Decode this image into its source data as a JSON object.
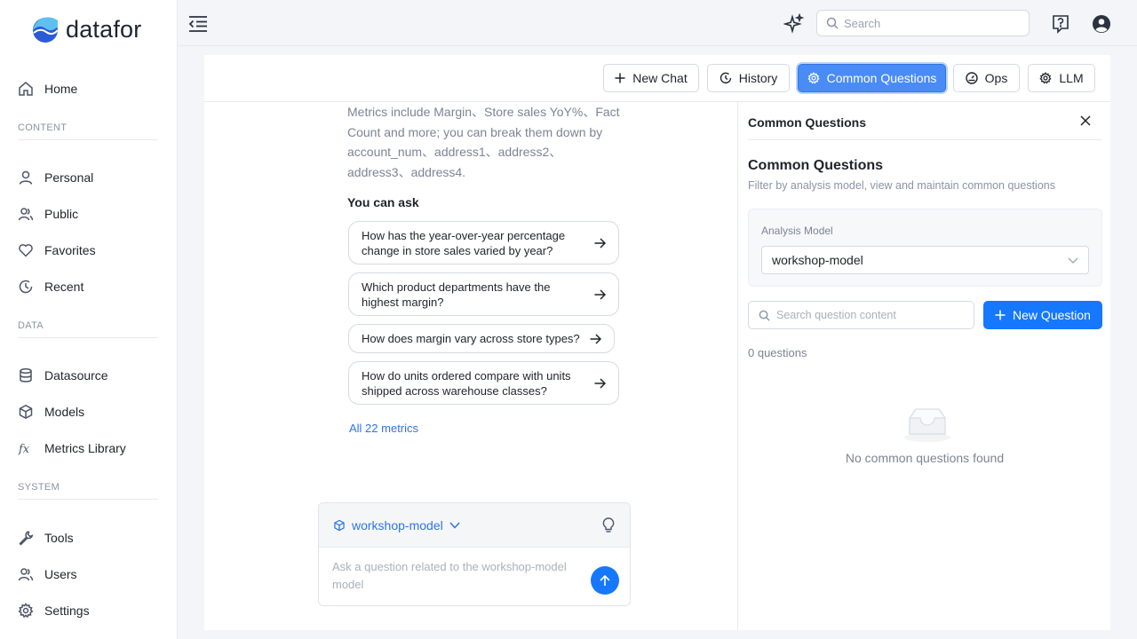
{
  "app": {
    "brand": "datafor"
  },
  "sidebar": {
    "home": "Home",
    "sections": {
      "content": "CONTENT",
      "data": "DATA",
      "system": "SYSTEM"
    },
    "content_items": [
      {
        "label": "Personal",
        "icon": "user-icon"
      },
      {
        "label": "Public",
        "icon": "users-icon"
      },
      {
        "label": "Favorites",
        "icon": "heart-icon"
      },
      {
        "label": "Recent",
        "icon": "clock-icon"
      }
    ],
    "data_items": [
      {
        "label": "Datasource",
        "icon": "database-icon"
      },
      {
        "label": "Models",
        "icon": "cube-icon"
      },
      {
        "label": "Metrics Library",
        "icon": "function-icon"
      }
    ],
    "system_items": [
      {
        "label": "Tools",
        "icon": "wrench-icon"
      },
      {
        "label": "Users",
        "icon": "users-icon"
      },
      {
        "label": "Settings",
        "icon": "gear-icon"
      }
    ]
  },
  "topbar": {
    "search_placeholder": "Search"
  },
  "toolbar": {
    "new_chat": "New Chat",
    "history": "History",
    "common_questions": "Common Questions",
    "ops": "Ops",
    "llm": "LLM",
    "active": "common_questions"
  },
  "chat": {
    "intro": "Metrics include Margin、Store sales YoY%、Fact Count and more; you can break them down by account_num、address1、address2、address3、address4.",
    "ask_title": "You can ask",
    "suggestions": [
      "How has the year-over-year percentage change in store sales varied by year?",
      "Which product departments have the highest margin?",
      "How does margin vary across store types?",
      "How do units ordered compare with units shipped across warehouse classes?"
    ],
    "all_metrics_link": "All 22 metrics",
    "composer": {
      "model": "workshop-model",
      "placeholder": "Ask a question related to the workshop-model model"
    }
  },
  "panel": {
    "title": "Common Questions",
    "heading": "Common Questions",
    "subtitle": "Filter by analysis model, view and maintain common questions",
    "model_label": "Analysis Model",
    "model_value": "workshop-model",
    "search_placeholder": "Search question content",
    "new_question": "New Question",
    "count": "0 questions",
    "empty": "No common questions found"
  },
  "colors": {
    "primary": "#1677ff",
    "active_tab": "#4a8cf7",
    "link": "#2f74e6"
  }
}
